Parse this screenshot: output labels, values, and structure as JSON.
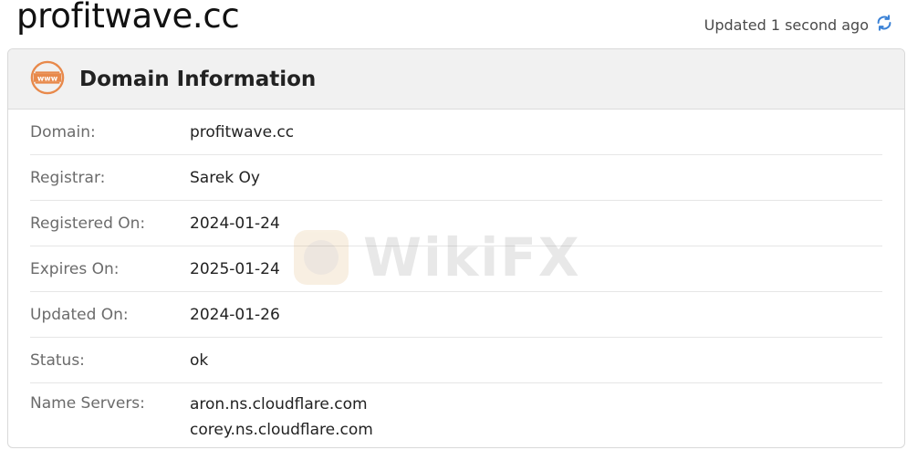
{
  "page": {
    "site_title": "profitwave.cc",
    "updated_text": "Updated 1 second ago",
    "refresh_icon": "refresh-icon",
    "watermark_text": "WikiFX"
  },
  "card": {
    "title": "Domain Information",
    "icon": "www-icon",
    "rows": [
      {
        "label": "Domain:",
        "value": "profitwave.cc"
      },
      {
        "label": "Registrar:",
        "value": "Sarek Oy"
      },
      {
        "label": "Registered On:",
        "value": "2024-01-24"
      },
      {
        "label": "Expires On:",
        "value": "2025-01-24"
      },
      {
        "label": "Updated On:",
        "value": "2024-01-26"
      },
      {
        "label": "Status:",
        "value": "ok"
      }
    ],
    "name_servers": {
      "label": "Name Servers:",
      "values": [
        "aron.ns.cloudflare.com",
        "corey.ns.cloudflare.com"
      ]
    }
  },
  "colors": {
    "header_bg": "#f1f1f1",
    "icon_orange": "#e8894b",
    "refresh_blue": "#3b82d6"
  }
}
